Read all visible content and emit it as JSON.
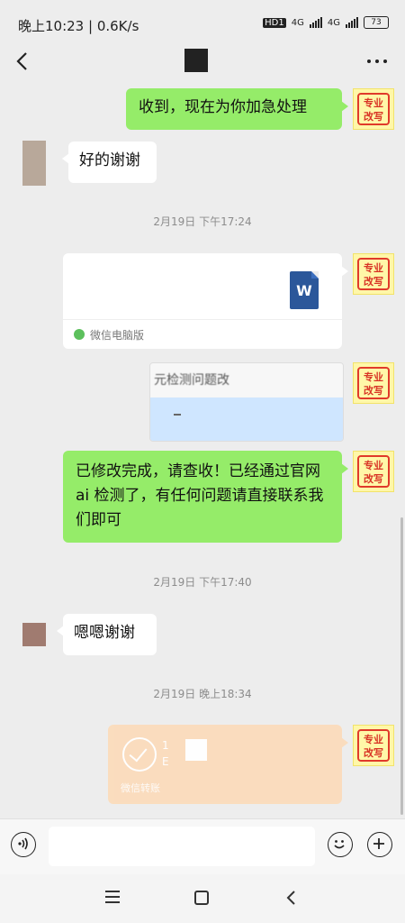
{
  "status": {
    "time_speed": "晚上10:23 | 0.6K/s",
    "hd": "HD1",
    "net1": "4G",
    "net2": "4G",
    "battery": "73"
  },
  "me_avatar": {
    "line1": "专业",
    "line2": "改写"
  },
  "messages": {
    "m1": "收到，现在为你加急处理",
    "m2": "好的谢谢",
    "t1": "2月19日 下午17:24",
    "file": {
      "source": "微信电脑版",
      "icon_letter": "W"
    },
    "image_text": "元检测问题改",
    "m3": "已修改完成，请查收！已经通过官网 ai 检测了，有任何问题请直接联系我们即可",
    "t2": "2月19日 下午17:40",
    "m4": "嗯嗯谢谢",
    "t3": "2月19日 晚上18:34",
    "transfer": {
      "amount_l1": "1",
      "amount_l2": "E",
      "label": "微信转账"
    }
  },
  "colors": {
    "green_bubble": "#95ec69",
    "background": "#ededed",
    "transfer": "#fbdcbc"
  }
}
